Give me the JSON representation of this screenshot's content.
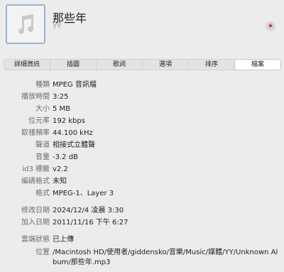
{
  "header": {
    "title": "那些年",
    "artist": "YY",
    "rating_icon": "star-icon"
  },
  "tabs": [
    {
      "label": "詳細資訊"
    },
    {
      "label": "插圖"
    },
    {
      "label": "歌詞"
    },
    {
      "label": "選項"
    },
    {
      "label": "排序"
    },
    {
      "label": "檔案"
    }
  ],
  "selected_tab": "檔案",
  "fields": {
    "kind": {
      "label": "種類",
      "value": "MPEG 音訊檔"
    },
    "duration": {
      "label": "播放時間",
      "value": "3:25"
    },
    "size": {
      "label": "大小",
      "value": "5 MB"
    },
    "bitrate": {
      "label": "位元率",
      "value": "192 kbps"
    },
    "sample_rate": {
      "label": "取樣頻率",
      "value": "44.100 kHz"
    },
    "channels": {
      "label": "聲道",
      "value": "相接式立體聲"
    },
    "volume": {
      "label": "音量",
      "value": "-3.2 dB"
    },
    "id3": {
      "label": "id3 標籤",
      "value": "v2.2"
    },
    "encoder": {
      "label": "編碼格式",
      "value": "未知"
    },
    "format": {
      "label": "格式",
      "value": "MPEG-1、Layer 3"
    },
    "modified": {
      "label": "修改日期",
      "value": "2024/12/4 凌晨 3:30"
    },
    "added": {
      "label": "加入日期",
      "value": "2011/11/16 下午 6:27"
    },
    "cloud": {
      "label": "雲端狀態",
      "value": "已上傳"
    },
    "location": {
      "label": "位置",
      "value": "/Macintosh HD/使用者/giddensko/音樂/Music/媒體/YY/Unknown Album/那些年.mp3"
    }
  }
}
